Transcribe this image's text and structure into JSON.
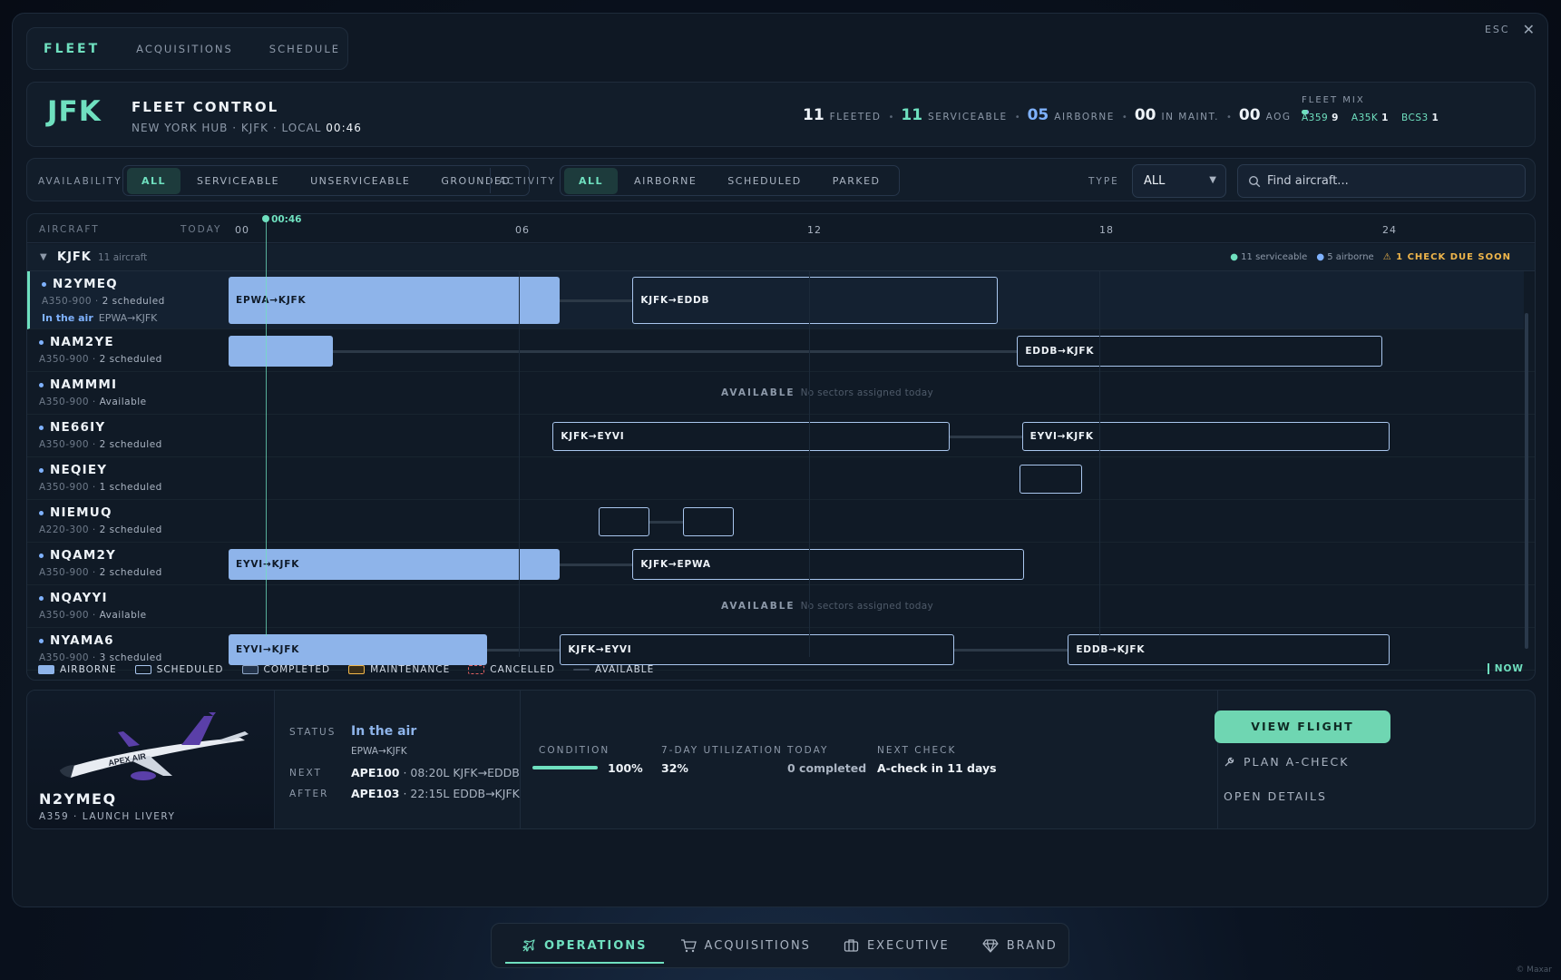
{
  "window": {
    "esc_label": "ESC"
  },
  "tabs": [
    {
      "label": "FLEET"
    },
    {
      "label": "ACQUISITIONS"
    },
    {
      "label": "SCHEDULE"
    }
  ],
  "header": {
    "code": "JFK",
    "title": "FLEET CONTROL",
    "subtitle": "NEW YORK HUB · KJFK · LOCAL",
    "local_time": "00:46",
    "stats": [
      {
        "value": "11",
        "label": "FLEETED"
      },
      {
        "value": "11",
        "label": "SERVICEABLE"
      },
      {
        "value": "05",
        "label": "AIRBORNE"
      },
      {
        "value": "00",
        "label": "IN MAINT."
      },
      {
        "value": "00",
        "label": "AOG"
      }
    ],
    "fleet_mix": {
      "label": "FLEET MIX",
      "items": [
        {
          "type": "A359",
          "count": "9"
        },
        {
          "type": "A35K",
          "count": "1"
        },
        {
          "type": "BCS3",
          "count": "1"
        }
      ]
    }
  },
  "filters": {
    "availability_label": "AVAILABILITY",
    "availability_options": [
      "ALL",
      "SERVICEABLE",
      "UNSERVICEABLE",
      "GROUNDED"
    ],
    "availability_selected": "ALL",
    "activity_label": "ACTIVITY",
    "activity_options": [
      "ALL",
      "AIRBORNE",
      "SCHEDULED",
      "PARKED"
    ],
    "activity_selected": "ALL",
    "type_label": "TYPE",
    "type_value": "ALL",
    "search_placeholder": "Find aircraft..."
  },
  "timeline": {
    "aircraft_label": "AIRCRAFT",
    "today_label": "TODAY",
    "ticks": [
      "00",
      "06",
      "12",
      "18",
      "24"
    ],
    "now_label": "00:46",
    "now_hour": 0.77,
    "group": {
      "name": "KJFK",
      "count": "11 aircraft",
      "serviceable": "11 serviceable",
      "airborne": "5 airborne",
      "warning": "1 CHECK DUE SOON"
    },
    "available_label": "AVAILABLE",
    "available_note": "No sectors assigned today",
    "rows": [
      {
        "reg": "N2YMEQ",
        "type": "A350-900",
        "info": "2 scheduled",
        "status": "In the air",
        "route": "EPWA→KJFK",
        "selected": true,
        "bars": [
          {
            "kind": "air",
            "start": 0,
            "end": 6.85,
            "label": "EPWA→KJFK"
          },
          {
            "kind": "sch",
            "start": 8.35,
            "end": 15.9,
            "label": "KJFK→EDDB"
          }
        ]
      },
      {
        "reg": "NAM2YE",
        "type": "A350-900",
        "info": "2 scheduled",
        "bars": [
          {
            "kind": "air",
            "start": 0,
            "end": 2.15,
            "label": ""
          },
          {
            "kind": "sch",
            "start": 16.3,
            "end": 23.85,
            "label": "EDDB→KJFK"
          }
        ]
      },
      {
        "reg": "NAMMMI",
        "type": "A350-900",
        "info": "Available",
        "available": true,
        "bars": []
      },
      {
        "reg": "NE66IY",
        "type": "A350-900",
        "info": "2 scheduled",
        "bars": [
          {
            "kind": "sch",
            "start": 6.7,
            "end": 14.9,
            "label": "KJFK→EYVI"
          },
          {
            "kind": "sch",
            "start": 16.4,
            "end": 24,
            "label": "EYVI→KJFK"
          }
        ]
      },
      {
        "reg": "NEQIEY",
        "type": "A350-900",
        "info": "1 scheduled",
        "bars": [
          {
            "kind": "sch",
            "start": 16.35,
            "end": 17.65,
            "label": ""
          }
        ]
      },
      {
        "reg": "NIEMUQ",
        "type": "A220-300",
        "info": "2 scheduled",
        "bars": [
          {
            "kind": "sch",
            "start": 7.65,
            "end": 8.7,
            "label": ""
          },
          {
            "kind": "sch",
            "start": 9.4,
            "end": 10.45,
            "label": ""
          }
        ]
      },
      {
        "reg": "NQAM2Y",
        "type": "A350-900",
        "info": "2 scheduled",
        "bars": [
          {
            "kind": "air",
            "start": 0,
            "end": 6.85,
            "label": "EYVI→KJFK"
          },
          {
            "kind": "sch",
            "start": 8.35,
            "end": 16.45,
            "label": "KJFK→EPWA"
          }
        ]
      },
      {
        "reg": "NQAYYI",
        "type": "A350-900",
        "info": "Available",
        "available": true,
        "bars": []
      },
      {
        "reg": "NYAMA6",
        "type": "A350-900",
        "info": "3 scheduled",
        "bars": [
          {
            "kind": "air",
            "start": 0,
            "end": 5.35,
            "label": "EYVI→KJFK"
          },
          {
            "kind": "sch",
            "start": 6.85,
            "end": 15.0,
            "label": "KJFK→EYVI"
          },
          {
            "kind": "sch",
            "start": 17.35,
            "end": 24,
            "label": "EDDB→KJFK"
          }
        ]
      }
    ]
  },
  "legend": {
    "items": [
      "AIRBORNE",
      "SCHEDULED",
      "COMPLETED",
      "MAINTENANCE",
      "CANCELLED",
      "AVAILABLE"
    ],
    "now": "NOW"
  },
  "detail": {
    "reg": "N2YMEQ",
    "subtitle": "A359 · LAUNCH LIVERY",
    "status_label": "STATUS",
    "status_value": "In the air",
    "status_route": "EPWA→KJFK",
    "next_label": "NEXT",
    "next_flight": "APE100",
    "next_info": "· 08:20L KJFK→EDDB",
    "after_label": "AFTER",
    "after_flight": "APE103",
    "after_info": "· 22:15L EDDB→KJFK",
    "condition_label": "CONDITION",
    "condition_value": "100%",
    "condition_fraction": 1.0,
    "util_label": "7-DAY UTILIZATION",
    "util_value": "32%",
    "today_label": "TODAY",
    "today_value": "0 completed",
    "check_label": "NEXT CHECK",
    "check_value": "A-check in 11 days",
    "view_flight": "VIEW FLIGHT",
    "plan_check": "PLAN A-CHECK",
    "open_details": "OPEN DETAILS",
    "livery_text": "APEX AIR"
  },
  "dock": [
    {
      "label": "OPERATIONS",
      "icon": "plane-icon"
    },
    {
      "label": "ACQUISITIONS",
      "icon": "cart-icon"
    },
    {
      "label": "EXECUTIVE",
      "icon": "briefcase-icon"
    },
    {
      "label": "BRAND",
      "icon": "diamond-icon"
    }
  ],
  "credit": "© Maxar",
  "colors": {
    "accent": "#6fe0bf",
    "airborne": "#8eb4ea",
    "scheduled": "#a9c6ee",
    "warning": "#f0b64b"
  }
}
